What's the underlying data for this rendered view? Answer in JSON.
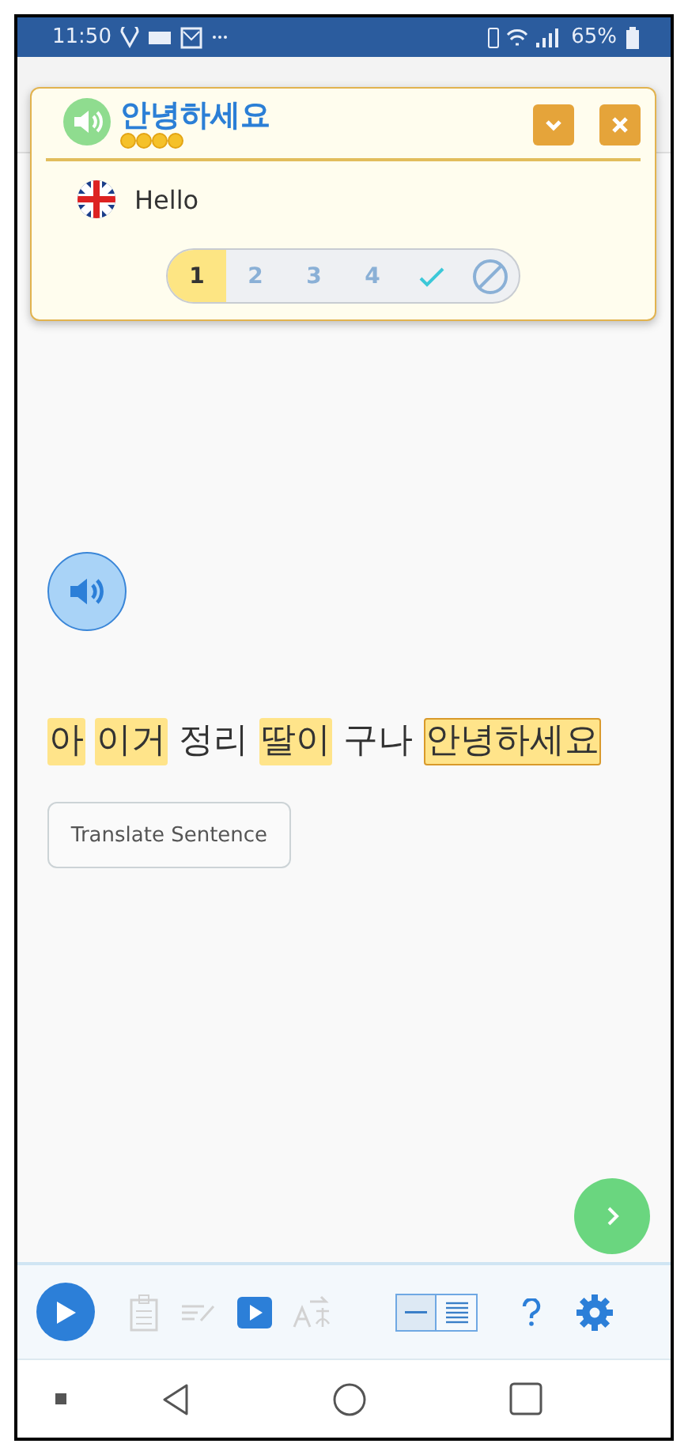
{
  "status_bar": {
    "time": "11:50",
    "battery": "65%"
  },
  "popup": {
    "term": "안녕하세요",
    "translation": "Hello",
    "levels": [
      {
        "kind": "number",
        "label": "1",
        "selected": true
      },
      {
        "kind": "number",
        "label": "2",
        "selected": false
      },
      {
        "kind": "number",
        "label": "3",
        "selected": false
      },
      {
        "kind": "number",
        "label": "4",
        "selected": false
      },
      {
        "kind": "known",
        "selected": false
      },
      {
        "kind": "ignore",
        "selected": false
      }
    ]
  },
  "sentence": {
    "words": [
      {
        "text": "아",
        "highlighted": true,
        "selected": false
      },
      {
        "text": "이거",
        "highlighted": true,
        "selected": false
      },
      {
        "text": "정리",
        "highlighted": false,
        "selected": false
      },
      {
        "text": "딸이",
        "highlighted": true,
        "selected": false
      },
      {
        "text": "구나",
        "highlighted": false,
        "selected": false
      },
      {
        "text": "안녕하세요",
        "highlighted": true,
        "selected": true
      }
    ]
  },
  "translate_button": "Translate Sentence",
  "toolbar": {
    "view_mode": [
      {
        "kind": "line",
        "selected": true
      },
      {
        "kind": "page",
        "selected": false
      }
    ]
  }
}
